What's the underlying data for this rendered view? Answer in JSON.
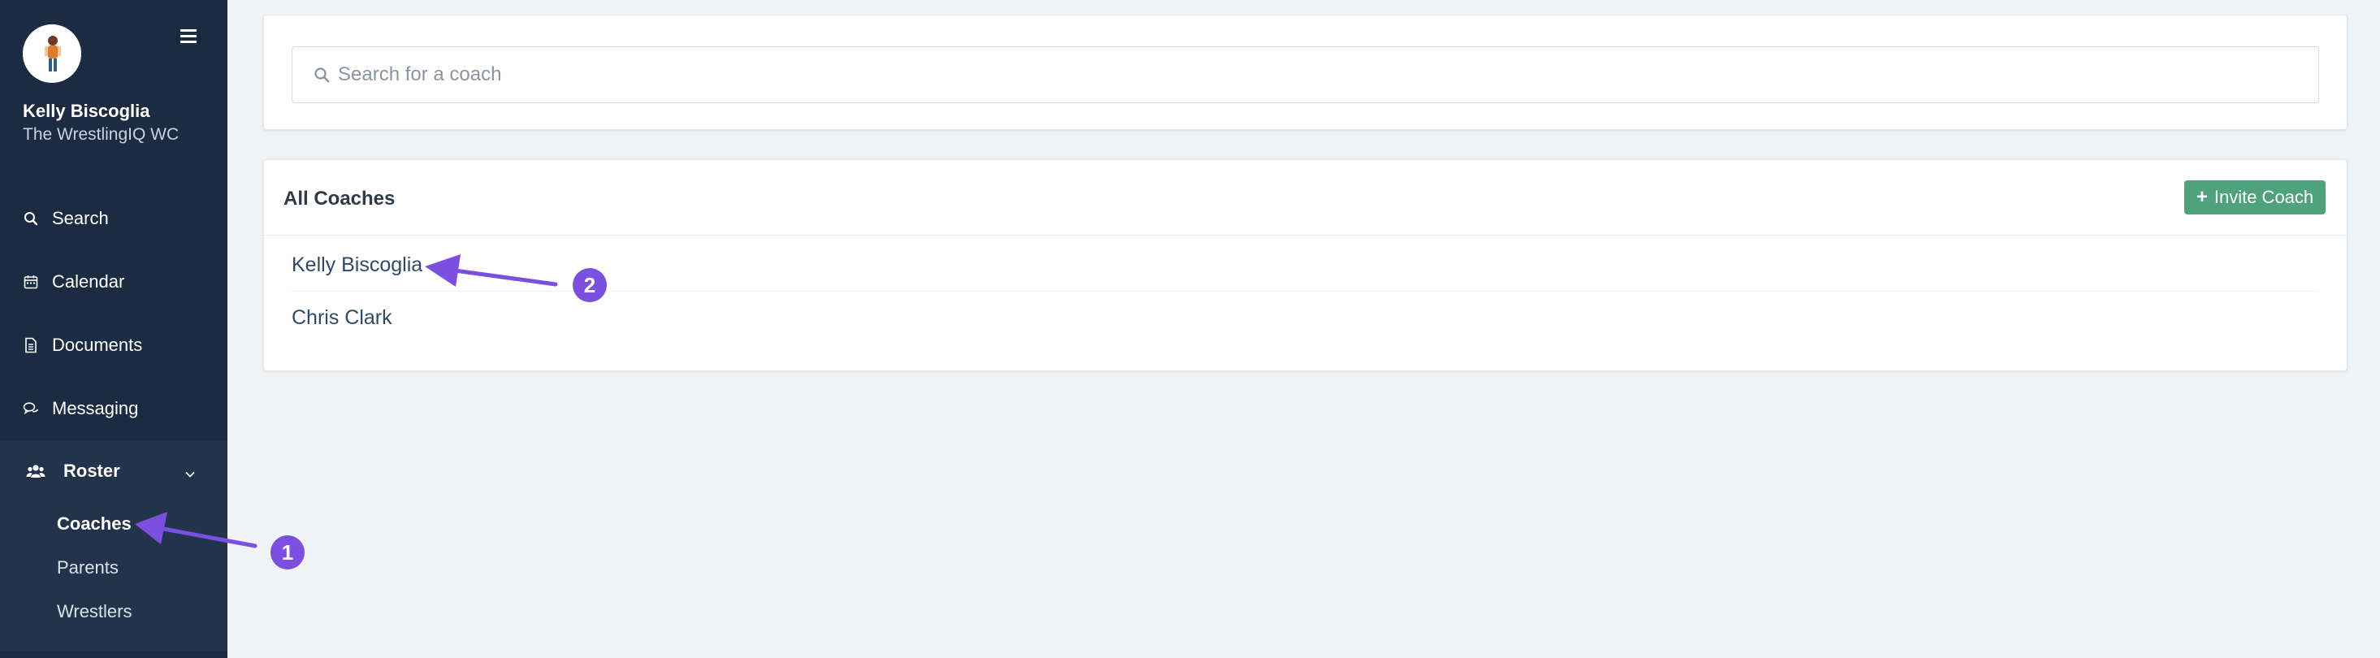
{
  "sidebar": {
    "user_name": "Kelly Biscoglia",
    "team_name": "The WrestlingIQ WC",
    "nav": [
      {
        "label": "Search",
        "icon": "search-icon"
      },
      {
        "label": "Calendar",
        "icon": "calendar-icon"
      },
      {
        "label": "Documents",
        "icon": "document-icon"
      },
      {
        "label": "Messaging",
        "icon": "messaging-icon"
      }
    ],
    "roster": {
      "label": "Roster",
      "icon": "users-icon",
      "expanded": true,
      "items": [
        {
          "label": "Coaches",
          "active": true
        },
        {
          "label": "Parents",
          "active": false
        },
        {
          "label": "Wrestlers",
          "active": false
        }
      ]
    }
  },
  "search": {
    "placeholder": "Search for a coach",
    "value": ""
  },
  "coaches": {
    "title": "All Coaches",
    "invite_label": "Invite Coach",
    "list": [
      "Kelly Biscoglia",
      "Chris Clark"
    ]
  },
  "annotations": {
    "step_1": "1",
    "step_2": "2"
  },
  "colors": {
    "sidebar_bg": "#1b2b41",
    "accent_green": "#4ea27c",
    "annotation_purple": "#7b4fe0",
    "page_bg": "#f0f3f6"
  }
}
